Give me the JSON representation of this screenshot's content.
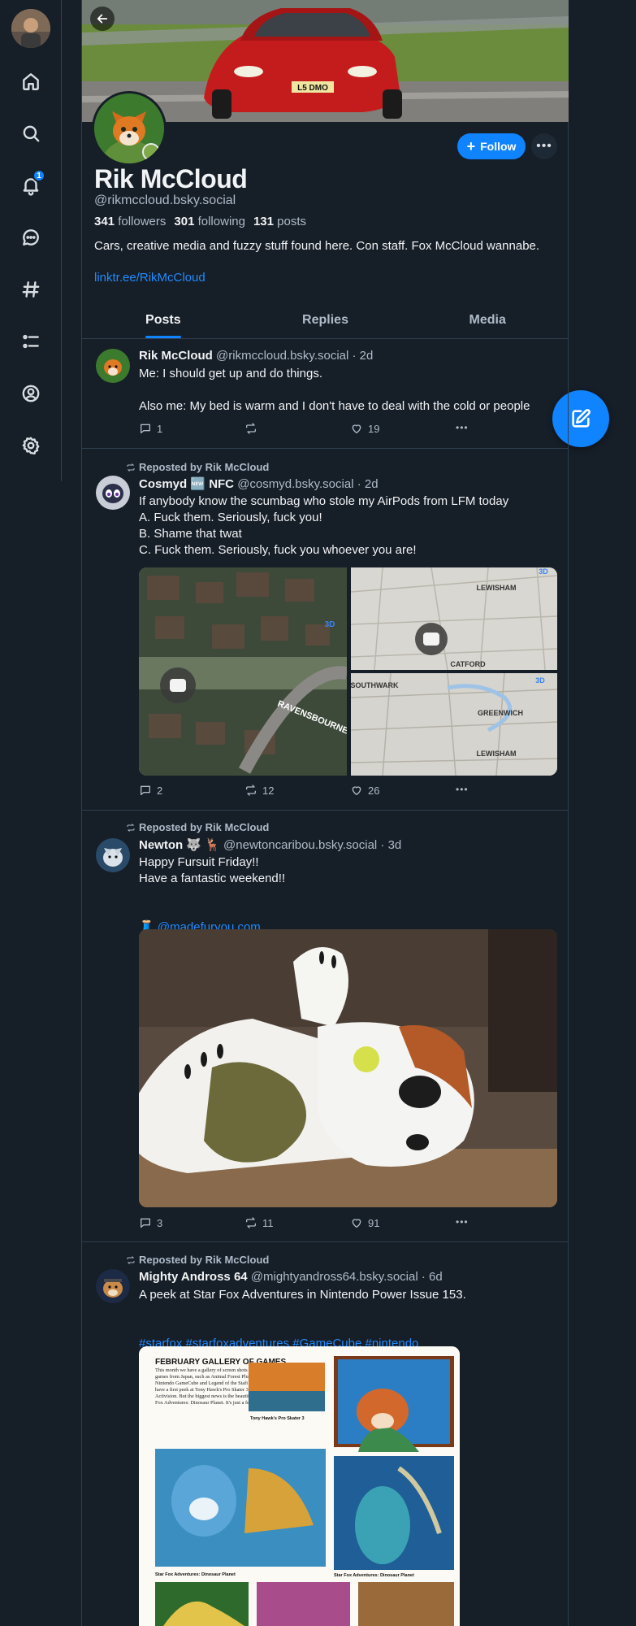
{
  "nav": {
    "items": [
      "home-icon",
      "search-icon",
      "bell-icon",
      "chat-icon",
      "hashtag-icon",
      "list-icon",
      "profile-icon",
      "gear-icon"
    ],
    "notification_count": "1"
  },
  "profile": {
    "display_name": "Rik McCloud",
    "handle": "@rikmccloud.bsky.social",
    "followers_count": "341",
    "followers_label": "followers",
    "following_count": "301",
    "following_label": "following",
    "posts_count": "131",
    "posts_label": "posts",
    "bio": "Cars, creative media and fuzzy stuff found here. Con staff. Fox McCloud wannabe.",
    "link": "linktr.ee/RikMcCloud",
    "follow_label": "Follow",
    "banner_plate": "L5 DMO"
  },
  "tabs": [
    {
      "label": "Posts",
      "active": true
    },
    {
      "label": "Replies",
      "active": false
    },
    {
      "label": "Media",
      "active": false
    }
  ],
  "posts": [
    {
      "repost_label": "",
      "name": "Rik McCloud",
      "handle": "@rikmccloud.bsky.social",
      "time": "· 2d",
      "text": "Me: I should get up and do things.\n\nAlso me: My bed is warm and I don't have to deal with the cold or people",
      "replies": "1",
      "reposts": "",
      "likes": "19"
    },
    {
      "repost_label": "Reposted by Rik McCloud",
      "name": "Cosmyd 🆕 NFC",
      "handle": "@cosmyd.bsky.social",
      "time": "· 2d",
      "text": "If anybody know the scumbag who stole my AirPods from LFM today\nA. Fuck them. Seriously, fuck you!\nB. Shame that twat\nC. Fuck them. Seriously, fuck you whoever you are!",
      "replies": "2",
      "reposts": "12",
      "likes": "26",
      "map_labels": [
        "RAVENSBOURNE ROAD",
        "LEWISHAM",
        "CATFORD",
        "SOUTHWARK",
        "GREENWICH",
        "LEWISHAM",
        "3D",
        "3D",
        "3D"
      ]
    },
    {
      "repost_label": "Reposted by Rik McCloud",
      "name": "Newton 🐺 🦌",
      "handle": "@newtoncaribou.bsky.social",
      "time": "· 3d",
      "text": "Happy Fursuit Friday!!\nHave a fantastic weekend!!",
      "link": "🧵 @madefuryou.com",
      "replies": "3",
      "reposts": "11",
      "likes": "91"
    },
    {
      "repost_label": "Reposted by Rik McCloud",
      "name": "Mighty Andross 64",
      "handle": "@mightyandross64.bsky.social",
      "time": "· 6d",
      "text": "A peek at Star Fox Adventures in Nintendo Power Issue 153.",
      "tags": "#starfox #starfoxadventures #GameCube #nintendo",
      "magazine_heading": "FEBRUARY GALLERY OF GAMES",
      "magazine_body": "This month we have a gallery of screen shots from upcoming titles and some games from Japan, such as Animal Forest Plus and Doshin the Giant for Nintendo GameCube and Legend of the Stafi for Game Boy Advance. We also have a first peek at Tony Hawk's Pro Skater 3 for Game Boy Advance from Activision. But the biggest news is the beautiful trio of screen shots from Star Fox Adventures: Dinosaur Planet. It's just a few months away.",
      "magazine_caption_1": "Star Fox Adventures: Dinosaur Planet",
      "magazine_caption_2": "Tony Hawk's Pro Skater 3",
      "magazine_caption_3": "Star Fox Adventures: Dinosaur Planet"
    }
  ],
  "colors": {
    "background": "#161e27",
    "accent": "#1083fe",
    "link": "#208bfe",
    "muted_text": "#aebbc9",
    "border": "#2e4052"
  }
}
